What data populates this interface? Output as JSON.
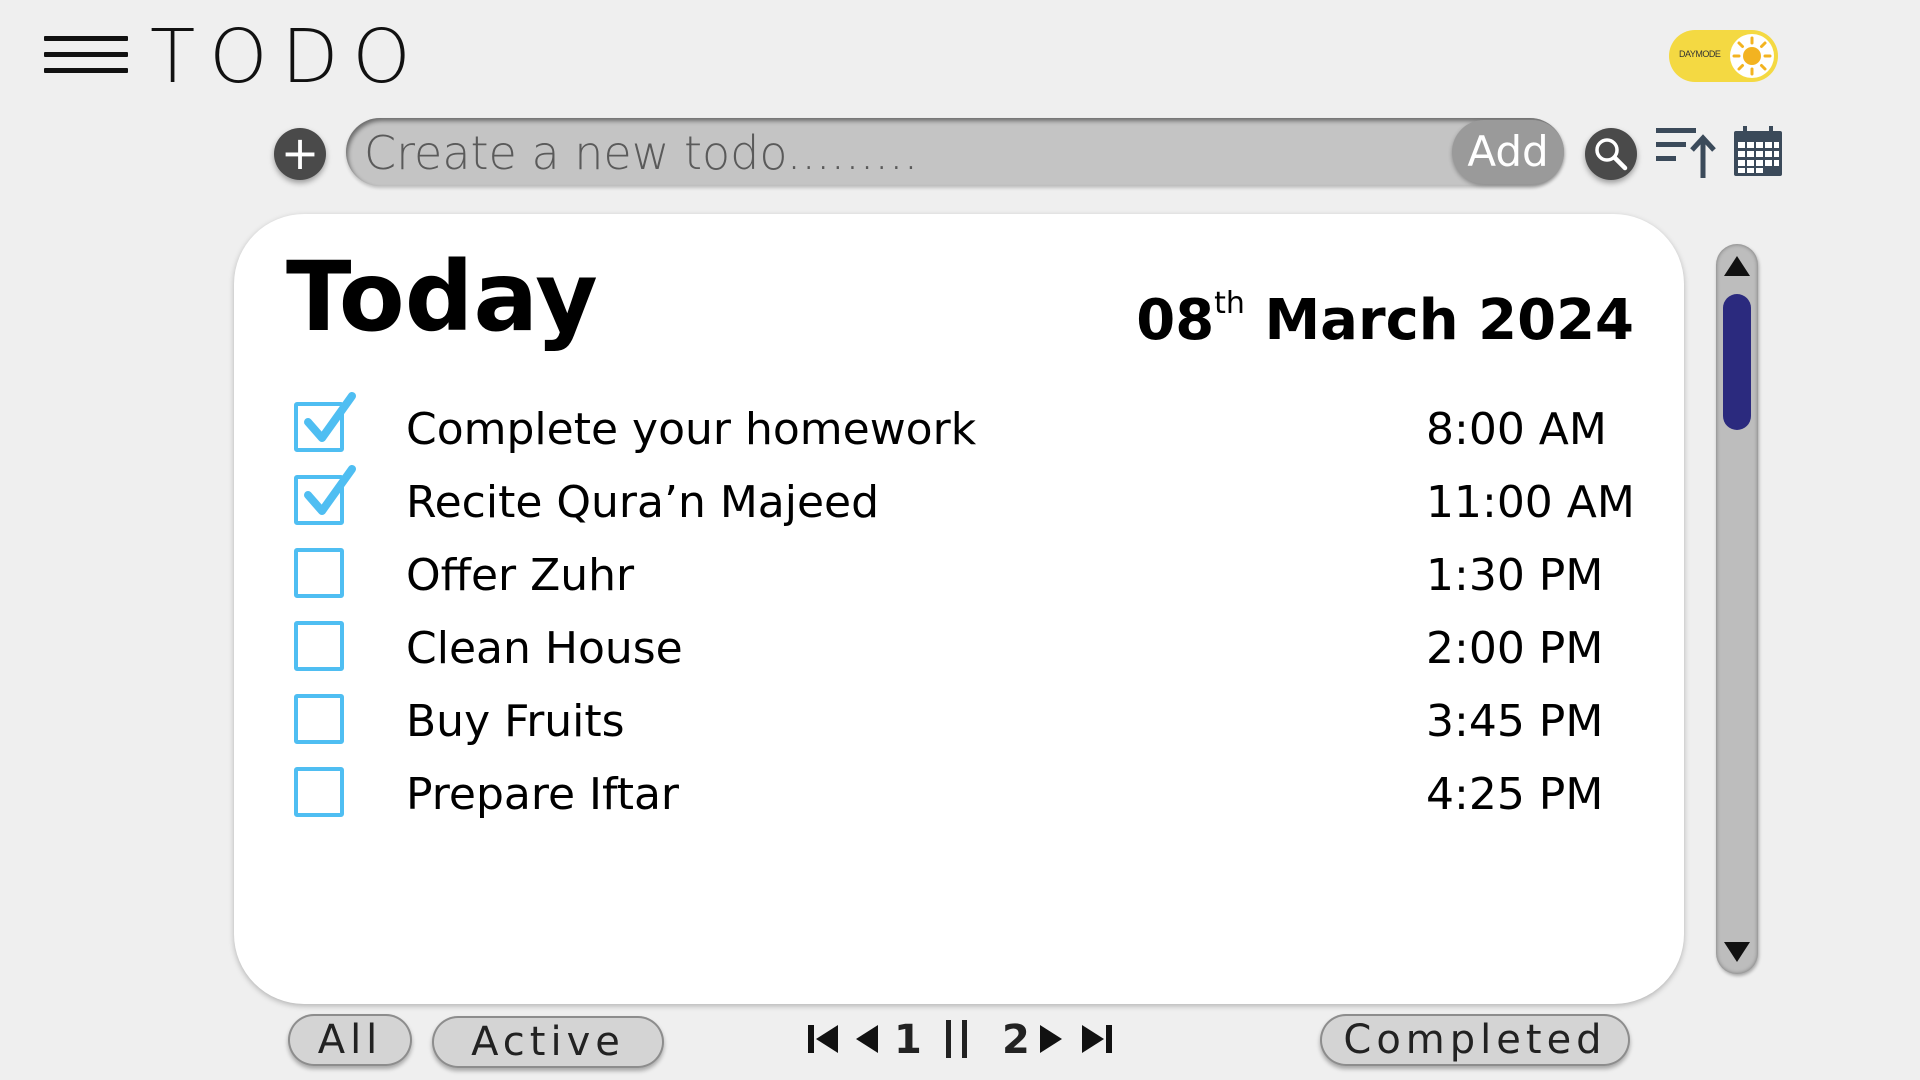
{
  "header": {
    "title": "TODO",
    "daymode_label": "DAYMODE"
  },
  "toolbar": {
    "input_placeholder": "Create a new todo.........",
    "add_label": "Add",
    "plus_glyph": "+"
  },
  "card": {
    "title": "Today",
    "date_day": "08",
    "date_suffix": "th",
    "date_rest": " March 2024",
    "tasks": [
      {
        "label": "Complete your homework",
        "time": "8:00 AM",
        "done": true
      },
      {
        "label": "Recite Qura’n Majeed",
        "time": "11:00 AM",
        "done": true
      },
      {
        "label": "Offer Zuhr",
        "time": "1:30 PM",
        "done": false
      },
      {
        "label": "Clean House",
        "time": "2:00 PM",
        "done": false
      },
      {
        "label": "Buy Fruits",
        "time": "3:45 PM",
        "done": false
      },
      {
        "label": "Prepare Iftar",
        "time": "4:25 PM",
        "done": false
      }
    ]
  },
  "filters": {
    "all": "All",
    "active": "Active",
    "completed": "Completed"
  },
  "pager": {
    "page_1": "1",
    "page_2": "2"
  },
  "icons": {
    "menu": "hamburger-menu-icon",
    "theme": "sun-icon",
    "add": "plus-icon",
    "search": "search-icon",
    "sort": "sort-ascending-icon",
    "calendar": "calendar-icon",
    "check": "check-icon"
  },
  "colors": {
    "accent_checkbox": "#4fbef2",
    "scroll_thumb": "#2b2a7e",
    "daymode_bg": "#f4d942",
    "background": "#efefef"
  }
}
